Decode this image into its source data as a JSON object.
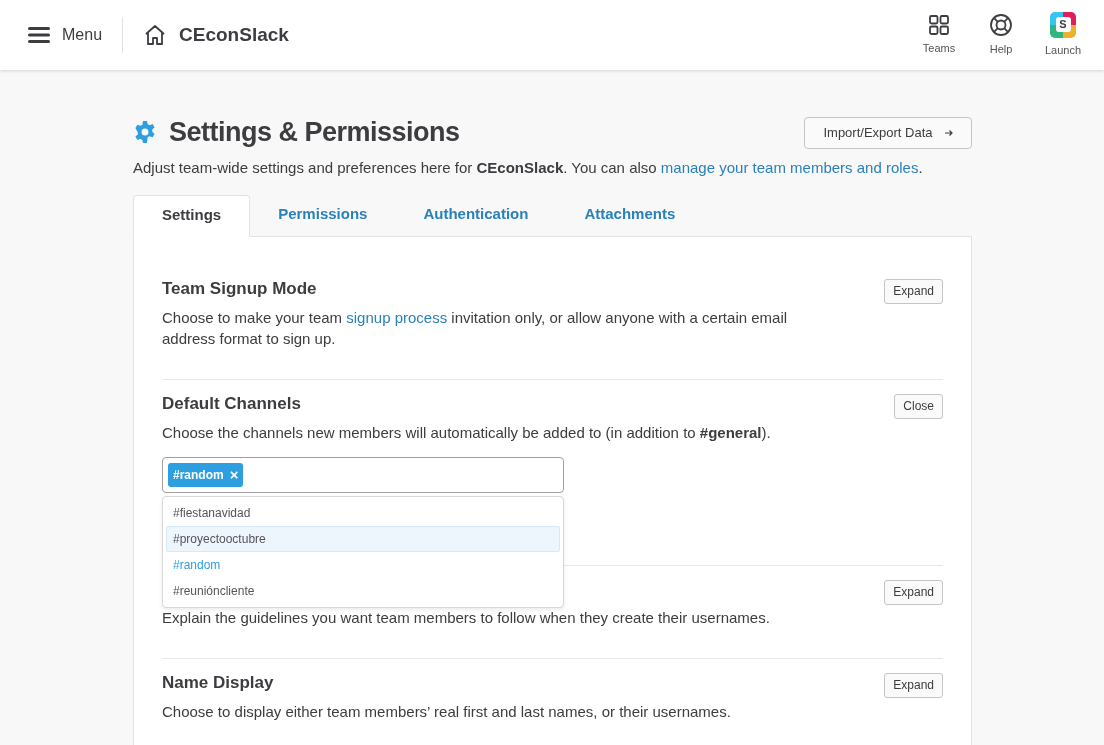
{
  "header": {
    "menu_label": "Menu",
    "team_name": "CEconSlack",
    "actions": [
      {
        "kind": "teams",
        "label": "Teams"
      },
      {
        "kind": "help",
        "label": "Help"
      },
      {
        "kind": "launch",
        "label": "Launch",
        "logo_letter": "S"
      }
    ]
  },
  "page": {
    "title": "Settings & Permissions",
    "import_button": "Import/Export Data",
    "intro": [
      {
        "kind": "text",
        "text": "Adjust team-wide settings and preferences here for **CEconSlack**. You can also "
      },
      {
        "kind": "link",
        "text": "manage your team members and roles"
      },
      {
        "kind": "text",
        "text": "."
      }
    ]
  },
  "tabs": [
    {
      "label": "Settings",
      "selected": true
    },
    {
      "label": "Permissions",
      "selected": false
    },
    {
      "label": "Authentication",
      "selected": false
    },
    {
      "label": "Attachments",
      "selected": false
    }
  ],
  "sections": [
    {
      "title": "Team Signup Mode",
      "button": "Expand",
      "description": [
        {
          "kind": "text",
          "text": "Choose to make your team "
        },
        {
          "kind": "link",
          "text": "signup process"
        },
        {
          "kind": "text",
          "text": " invitation only, or allow anyone with a certain email address format to sign up."
        }
      ]
    },
    {
      "title": "Default Channels",
      "button": "Close",
      "description": [
        {
          "kind": "text",
          "text": "Choose the channels new members will automatically be added to (in addition to **#general**)."
        }
      ],
      "tokens": [
        {
          "label": "#random",
          "remove": "×"
        }
      ],
      "dropdown": [
        {
          "label": "#fiestanavidad",
          "highlighted": false,
          "added": false
        },
        {
          "label": "#proyectooctubre",
          "highlighted": true,
          "added": false
        },
        {
          "label": "#random",
          "highlighted": false,
          "added": true
        },
        {
          "label": "#reunióncliente",
          "highlighted": false,
          "added": false
        }
      ]
    },
    {
      "button": "Expand",
      "description": [
        {
          "kind": "text",
          "text": "Explain the guidelines you want team members to follow when they create their usernames."
        }
      ]
    },
    {
      "title": "Name Display",
      "button": "Expand",
      "description": [
        {
          "kind": "text",
          "text": "Choose to display either team members’ real first and last names, or their usernames."
        }
      ]
    }
  ]
}
